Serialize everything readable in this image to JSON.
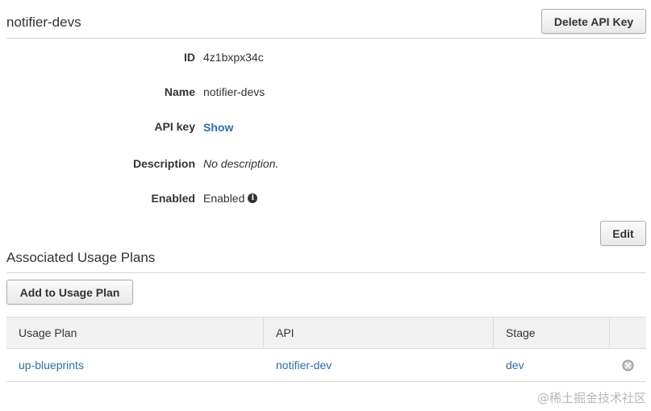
{
  "api_key": {
    "title": "notifier-devs",
    "delete_label": "Delete API Key",
    "edit_label": "Edit"
  },
  "properties": [
    {
      "label": "ID",
      "value": "4z1bxpx34c"
    },
    {
      "label": "Name",
      "value": "notifier-devs"
    },
    {
      "label": "API key",
      "value": "Show"
    },
    {
      "label": "Description",
      "value": "No description."
    },
    {
      "label": "Enabled",
      "value": "Enabled"
    }
  ],
  "usage_plans": {
    "title": "Associated Usage Plans",
    "add_label": "Add to Usage Plan",
    "columns": [
      "Usage Plan",
      "API",
      "Stage"
    ],
    "rows": [
      {
        "usage_plan": "up-blueprints",
        "api": "notifier-dev",
        "stage": "dev"
      }
    ]
  },
  "icons": {
    "enabled_info": "info-icon",
    "row_remove": "remove-icon"
  },
  "colors": {
    "link": "#2e6ca4",
    "header_bg": "#f2f2f2"
  },
  "watermark": "@稀土掘金技术社区"
}
